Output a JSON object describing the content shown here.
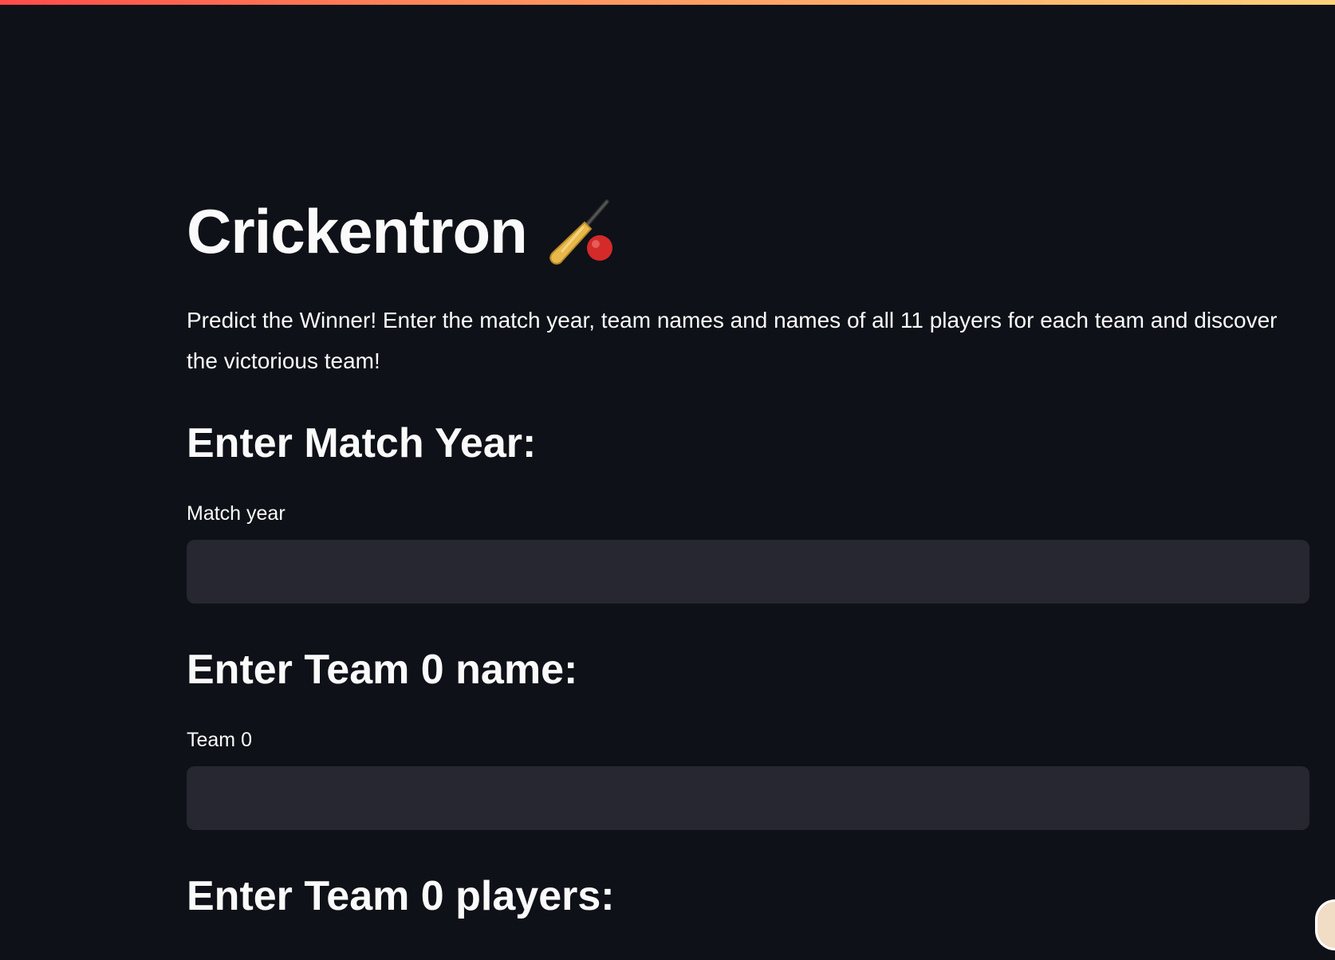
{
  "app": {
    "title": "Crickentron",
    "title_icon": "cricket-bat-ball-icon",
    "description": "Predict the Winner! Enter the match year, team names and names of all 11 players for each team and discover the victorious team!"
  },
  "sections": {
    "match_year": {
      "heading": "Enter Match Year:",
      "label": "Match year",
      "value": ""
    },
    "team0_name": {
      "heading": "Enter Team 0 name:",
      "label": "Team 0",
      "value": ""
    },
    "team0_players": {
      "heading": "Enter Team 0 players:"
    }
  },
  "colors": {
    "background": "#0e1117",
    "input_background": "#262730",
    "text": "#fafafa",
    "accent_gradient_start": "#ff4b4b",
    "accent_gradient_end": "#ffd27a"
  }
}
